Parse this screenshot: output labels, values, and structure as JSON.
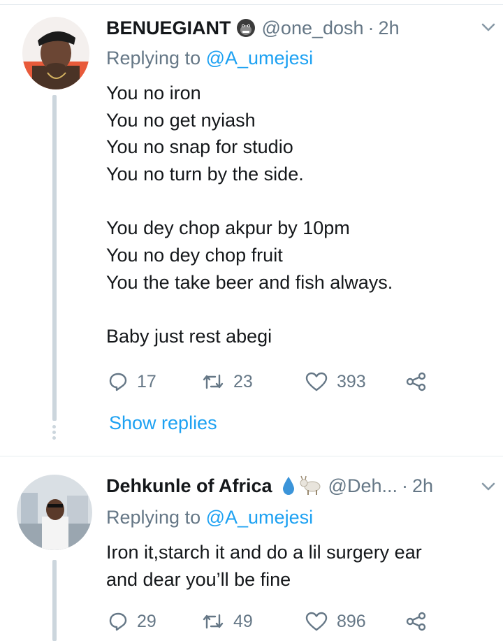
{
  "colors": {
    "accent": "#1da1f2",
    "muted": "#657786",
    "text": "#14171a",
    "thread": "#ccd6dd"
  },
  "tweets": [
    {
      "name": "BENUEGIANT",
      "name_emoji": "gorilla-emoji",
      "handle": "@one_dosh",
      "sep": "·",
      "time": "2h",
      "reply_prefix": "Replying to",
      "reply_mention": "@A_umejesi",
      "lines": [
        "You no iron",
        "You no get nyiash",
        "You no snap for studio",
        "You no turn by the side.",
        "",
        "You dey chop akpur by 10pm",
        "You no dey chop fruit",
        "You the take beer and fish always.",
        "",
        "Baby just rest abegi"
      ],
      "replies": "17",
      "retweets": "23",
      "likes": "393",
      "show_replies": "Show replies"
    },
    {
      "name": "Dehkunle of Africa",
      "name_emoji": "droplet-and-goat-emoji",
      "handle": "@Deh...",
      "sep": "·",
      "time": "2h",
      "reply_prefix": "Replying to",
      "reply_mention": "@A_umejesi",
      "lines": [
        "Iron it,starch it and do a lil surgery ear",
        "and dear you’ll be fine"
      ],
      "replies": "29",
      "retweets": "49",
      "likes": "896"
    }
  ]
}
